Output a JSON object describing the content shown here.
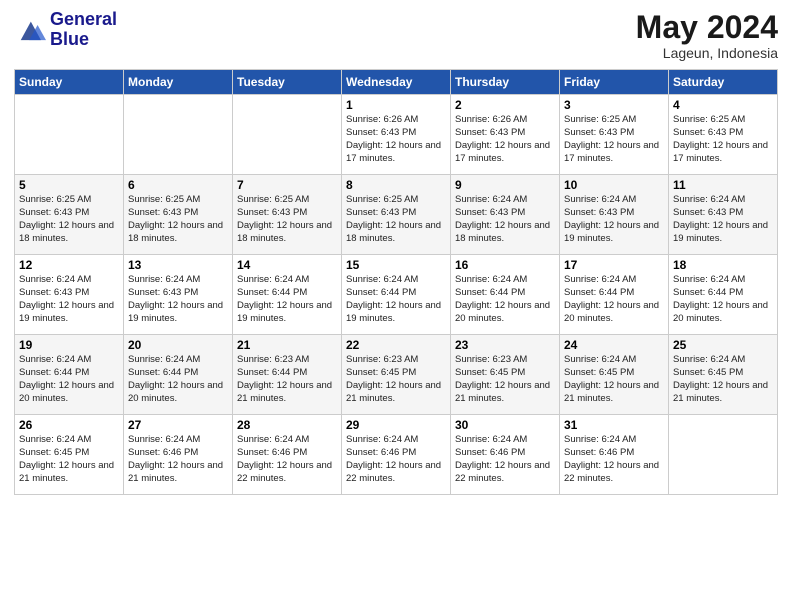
{
  "logo": {
    "line1": "General",
    "line2": "Blue"
  },
  "header": {
    "month": "May 2024",
    "location": "Lageun, Indonesia"
  },
  "weekdays": [
    "Sunday",
    "Monday",
    "Tuesday",
    "Wednesday",
    "Thursday",
    "Friday",
    "Saturday"
  ],
  "weeks": [
    [
      {
        "day": "",
        "sunrise": "",
        "sunset": "",
        "daylight": ""
      },
      {
        "day": "",
        "sunrise": "",
        "sunset": "",
        "daylight": ""
      },
      {
        "day": "",
        "sunrise": "",
        "sunset": "",
        "daylight": ""
      },
      {
        "day": "1",
        "sunrise": "Sunrise: 6:26 AM",
        "sunset": "Sunset: 6:43 PM",
        "daylight": "Daylight: 12 hours and 17 minutes."
      },
      {
        "day": "2",
        "sunrise": "Sunrise: 6:26 AM",
        "sunset": "Sunset: 6:43 PM",
        "daylight": "Daylight: 12 hours and 17 minutes."
      },
      {
        "day": "3",
        "sunrise": "Sunrise: 6:25 AM",
        "sunset": "Sunset: 6:43 PM",
        "daylight": "Daylight: 12 hours and 17 minutes."
      },
      {
        "day": "4",
        "sunrise": "Sunrise: 6:25 AM",
        "sunset": "Sunset: 6:43 PM",
        "daylight": "Daylight: 12 hours and 17 minutes."
      }
    ],
    [
      {
        "day": "5",
        "sunrise": "Sunrise: 6:25 AM",
        "sunset": "Sunset: 6:43 PM",
        "daylight": "Daylight: 12 hours and 18 minutes."
      },
      {
        "day": "6",
        "sunrise": "Sunrise: 6:25 AM",
        "sunset": "Sunset: 6:43 PM",
        "daylight": "Daylight: 12 hours and 18 minutes."
      },
      {
        "day": "7",
        "sunrise": "Sunrise: 6:25 AM",
        "sunset": "Sunset: 6:43 PM",
        "daylight": "Daylight: 12 hours and 18 minutes."
      },
      {
        "day": "8",
        "sunrise": "Sunrise: 6:25 AM",
        "sunset": "Sunset: 6:43 PM",
        "daylight": "Daylight: 12 hours and 18 minutes."
      },
      {
        "day": "9",
        "sunrise": "Sunrise: 6:24 AM",
        "sunset": "Sunset: 6:43 PM",
        "daylight": "Daylight: 12 hours and 18 minutes."
      },
      {
        "day": "10",
        "sunrise": "Sunrise: 6:24 AM",
        "sunset": "Sunset: 6:43 PM",
        "daylight": "Daylight: 12 hours and 19 minutes."
      },
      {
        "day": "11",
        "sunrise": "Sunrise: 6:24 AM",
        "sunset": "Sunset: 6:43 PM",
        "daylight": "Daylight: 12 hours and 19 minutes."
      }
    ],
    [
      {
        "day": "12",
        "sunrise": "Sunrise: 6:24 AM",
        "sunset": "Sunset: 6:43 PM",
        "daylight": "Daylight: 12 hours and 19 minutes."
      },
      {
        "day": "13",
        "sunrise": "Sunrise: 6:24 AM",
        "sunset": "Sunset: 6:43 PM",
        "daylight": "Daylight: 12 hours and 19 minutes."
      },
      {
        "day": "14",
        "sunrise": "Sunrise: 6:24 AM",
        "sunset": "Sunset: 6:44 PM",
        "daylight": "Daylight: 12 hours and 19 minutes."
      },
      {
        "day": "15",
        "sunrise": "Sunrise: 6:24 AM",
        "sunset": "Sunset: 6:44 PM",
        "daylight": "Daylight: 12 hours and 19 minutes."
      },
      {
        "day": "16",
        "sunrise": "Sunrise: 6:24 AM",
        "sunset": "Sunset: 6:44 PM",
        "daylight": "Daylight: 12 hours and 20 minutes."
      },
      {
        "day": "17",
        "sunrise": "Sunrise: 6:24 AM",
        "sunset": "Sunset: 6:44 PM",
        "daylight": "Daylight: 12 hours and 20 minutes."
      },
      {
        "day": "18",
        "sunrise": "Sunrise: 6:24 AM",
        "sunset": "Sunset: 6:44 PM",
        "daylight": "Daylight: 12 hours and 20 minutes."
      }
    ],
    [
      {
        "day": "19",
        "sunrise": "Sunrise: 6:24 AM",
        "sunset": "Sunset: 6:44 PM",
        "daylight": "Daylight: 12 hours and 20 minutes."
      },
      {
        "day": "20",
        "sunrise": "Sunrise: 6:24 AM",
        "sunset": "Sunset: 6:44 PM",
        "daylight": "Daylight: 12 hours and 20 minutes."
      },
      {
        "day": "21",
        "sunrise": "Sunrise: 6:23 AM",
        "sunset": "Sunset: 6:44 PM",
        "daylight": "Daylight: 12 hours and 21 minutes."
      },
      {
        "day": "22",
        "sunrise": "Sunrise: 6:23 AM",
        "sunset": "Sunset: 6:45 PM",
        "daylight": "Daylight: 12 hours and 21 minutes."
      },
      {
        "day": "23",
        "sunrise": "Sunrise: 6:23 AM",
        "sunset": "Sunset: 6:45 PM",
        "daylight": "Daylight: 12 hours and 21 minutes."
      },
      {
        "day": "24",
        "sunrise": "Sunrise: 6:24 AM",
        "sunset": "Sunset: 6:45 PM",
        "daylight": "Daylight: 12 hours and 21 minutes."
      },
      {
        "day": "25",
        "sunrise": "Sunrise: 6:24 AM",
        "sunset": "Sunset: 6:45 PM",
        "daylight": "Daylight: 12 hours and 21 minutes."
      }
    ],
    [
      {
        "day": "26",
        "sunrise": "Sunrise: 6:24 AM",
        "sunset": "Sunset: 6:45 PM",
        "daylight": "Daylight: 12 hours and 21 minutes."
      },
      {
        "day": "27",
        "sunrise": "Sunrise: 6:24 AM",
        "sunset": "Sunset: 6:46 PM",
        "daylight": "Daylight: 12 hours and 21 minutes."
      },
      {
        "day": "28",
        "sunrise": "Sunrise: 6:24 AM",
        "sunset": "Sunset: 6:46 PM",
        "daylight": "Daylight: 12 hours and 22 minutes."
      },
      {
        "day": "29",
        "sunrise": "Sunrise: 6:24 AM",
        "sunset": "Sunset: 6:46 PM",
        "daylight": "Daylight: 12 hours and 22 minutes."
      },
      {
        "day": "30",
        "sunrise": "Sunrise: 6:24 AM",
        "sunset": "Sunset: 6:46 PM",
        "daylight": "Daylight: 12 hours and 22 minutes."
      },
      {
        "day": "31",
        "sunrise": "Sunrise: 6:24 AM",
        "sunset": "Sunset: 6:46 PM",
        "daylight": "Daylight: 12 hours and 22 minutes."
      },
      {
        "day": "",
        "sunrise": "",
        "sunset": "",
        "daylight": ""
      }
    ]
  ]
}
